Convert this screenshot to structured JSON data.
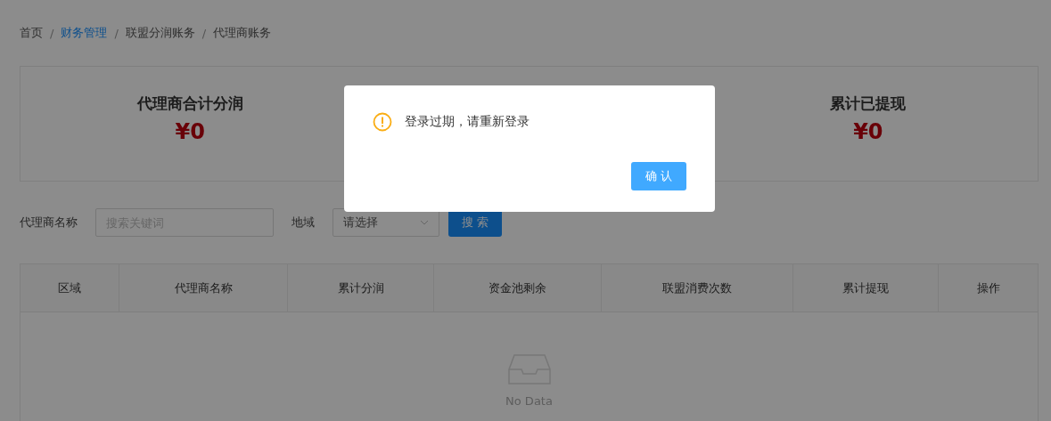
{
  "breadcrumb": [
    {
      "label": "首页",
      "selected": false
    },
    {
      "label": "财务管理",
      "selected": true
    },
    {
      "label": "联盟分润账务",
      "selected": false
    },
    {
      "label": "代理商账务",
      "selected": false
    }
  ],
  "breadcrumb_separator": "/",
  "stats": [
    {
      "label": "代理商合计分润",
      "value": "¥0"
    },
    {
      "label": "累计已提现",
      "value": "¥0"
    }
  ],
  "filters": {
    "name_label": "代理商名称",
    "name_placeholder": "搜索关键词",
    "region_label": "地域",
    "region_placeholder": "请选择",
    "search_button": "搜 索"
  },
  "table": {
    "columns": [
      "区域",
      "代理商名称",
      "累计分润",
      "资金池剩余",
      "联盟消费次数",
      "累计提现",
      "操作"
    ],
    "empty_text": "No Data"
  },
  "dialog": {
    "message": "登录过期，请重新登录",
    "confirm_button": "确 认"
  }
}
